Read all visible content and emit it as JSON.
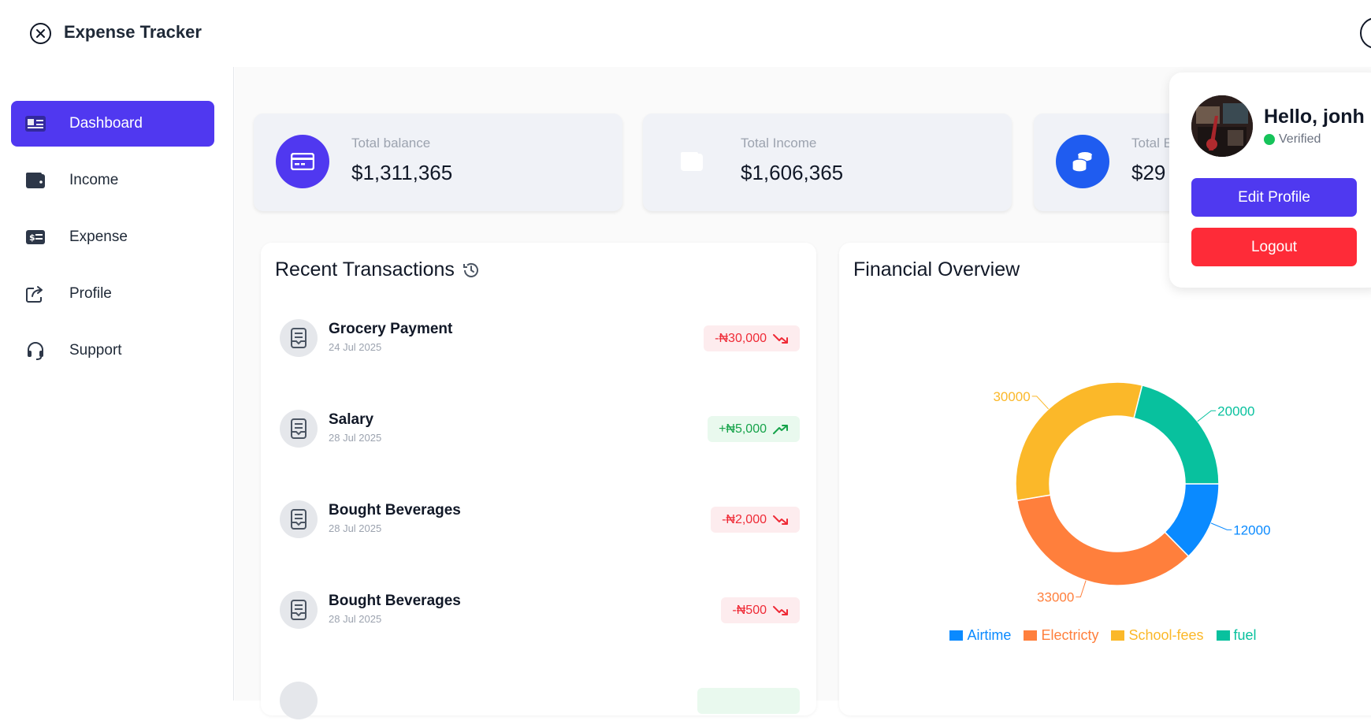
{
  "app": {
    "title": "Expense Tracker"
  },
  "sidebar": {
    "items": [
      {
        "label": "Dashboard",
        "icon": "dashboard-icon",
        "active": true
      },
      {
        "label": "Income",
        "icon": "wallet-icon"
      },
      {
        "label": "Expense",
        "icon": "money-icon"
      },
      {
        "label": "Profile",
        "icon": "share-icon"
      },
      {
        "label": "Support",
        "icon": "headset-icon"
      }
    ]
  },
  "stats": [
    {
      "label": "Total balance",
      "value": "$1,311,365",
      "icon": "credit-card-icon",
      "color": "#5038f0"
    },
    {
      "label": "Total Income",
      "value": "$1,606,365",
      "icon": "wallet-icon",
      "color": "#ffffff"
    },
    {
      "label": "Total E",
      "value": "$29",
      "icon": "coins-icon",
      "color": "#1f5cf0"
    }
  ],
  "transactions": {
    "title": "Recent Transactions",
    "title_icon": "history-icon",
    "items": [
      {
        "title": "Grocery Payment",
        "date": "24 Jul 2025",
        "amount": "-₦30,000",
        "type": "expense"
      },
      {
        "title": "Salary",
        "date": "28 Jul 2025",
        "amount": "+₦5,000",
        "type": "income"
      },
      {
        "title": "Bought Beverages",
        "date": "28 Jul 2025",
        "amount": "-₦2,000",
        "type": "expense"
      },
      {
        "title": "Bought Beverages",
        "date": "28 Jul 2025",
        "amount": "-₦500",
        "type": "expense"
      }
    ]
  },
  "overview": {
    "title": "Financial Overview"
  },
  "chart_data": {
    "type": "pie",
    "donut": true,
    "categories": [
      "Airtime",
      "Electricty",
      "School-fees",
      "fuel"
    ],
    "values": [
      12000,
      33000,
      30000,
      20000
    ],
    "colors": [
      "#0a8aff",
      "#ff7f3c",
      "#fbb829",
      "#08c19e"
    ],
    "data_labels": [
      "12000",
      "33000",
      "30000",
      "20000"
    ],
    "legend": "bottom"
  },
  "profile": {
    "greeting": "Hello, jonh",
    "status": "Verified",
    "edit_label": "Edit Profile",
    "logout_label": "Logout",
    "edit_color": "#4f39f0",
    "logout_color": "#fe2b38"
  }
}
